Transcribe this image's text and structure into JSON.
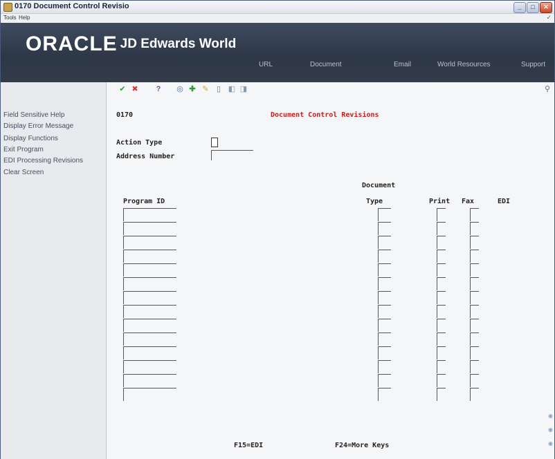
{
  "window": {
    "title": "0170   Document Control Revisio",
    "menu": [
      "Tools",
      "Help"
    ]
  },
  "banner": {
    "logo_oracle": "ORACLE",
    "logo_product": "JD Edwards World",
    "nav": [
      "URL",
      "Document",
      "Email",
      "World Resources",
      "Support"
    ]
  },
  "sidebar": {
    "items": [
      "Field Sensitive Help",
      "Display Error Message",
      "Display Functions",
      "Exit Program",
      "EDI Processing Revisions",
      "Clear Screen"
    ]
  },
  "toolbar": {
    "icons": [
      "check-icon",
      "cancel-icon",
      "help-icon",
      "binoculars-icon",
      "add-icon",
      "edit-icon",
      "delete-icon",
      "previous-icon",
      "next-icon",
      "search-icon"
    ]
  },
  "form": {
    "program_code": "0170",
    "title": "Document Control Revisions",
    "action_type_label": "Action Type",
    "action_type_value": "",
    "address_number_label": "Address Number",
    "address_number_value": ""
  },
  "grid": {
    "header_doc_top": "Document",
    "columns": [
      "Program ID",
      "Type",
      "Print",
      "Fax",
      "EDI"
    ],
    "row_count": 14
  },
  "footer": {
    "keys": [
      "F15=EDI",
      "F24=More Keys"
    ]
  },
  "colors": {
    "banner": "#2c3646",
    "title_red": "#c02020",
    "sidebar_bg": "#e8eaed"
  }
}
